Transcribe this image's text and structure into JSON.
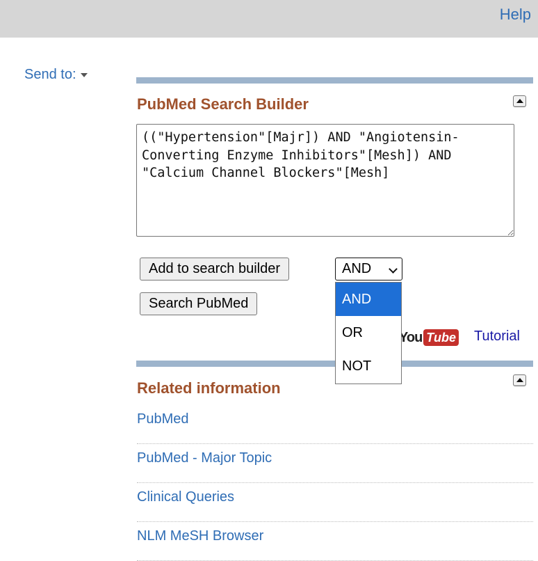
{
  "header": {
    "help_label": "Help"
  },
  "send_to": {
    "label": "Send to:"
  },
  "search_builder": {
    "title": "PubMed Search Builder",
    "query": "((\"Hypertension\"[Majr]) AND \"Angiotensin-Converting Enzyme Inhibitors\"[Mesh]) AND \"Calcium Channel Blockers\"[Mesh]",
    "add_button_label": "Add to search builder",
    "operator": {
      "selected": "AND",
      "options": [
        "AND",
        "OR",
        "NOT"
      ]
    },
    "search_button_label": "Search PubMed",
    "youtube": {
      "you": "You",
      "tube": "Tube"
    },
    "tutorial_label": "Tutorial"
  },
  "related": {
    "title": "Related information",
    "items": [
      "PubMed",
      "PubMed - Major Topic",
      "Clinical Queries",
      "NLM MeSH Browser"
    ]
  },
  "colors": {
    "link": "#2f6db5",
    "section_title": "#a0522d",
    "section_bar": "#9db4cc",
    "dropdown_selected": "#1e6fd6",
    "youtube_red": "#c4302b"
  }
}
